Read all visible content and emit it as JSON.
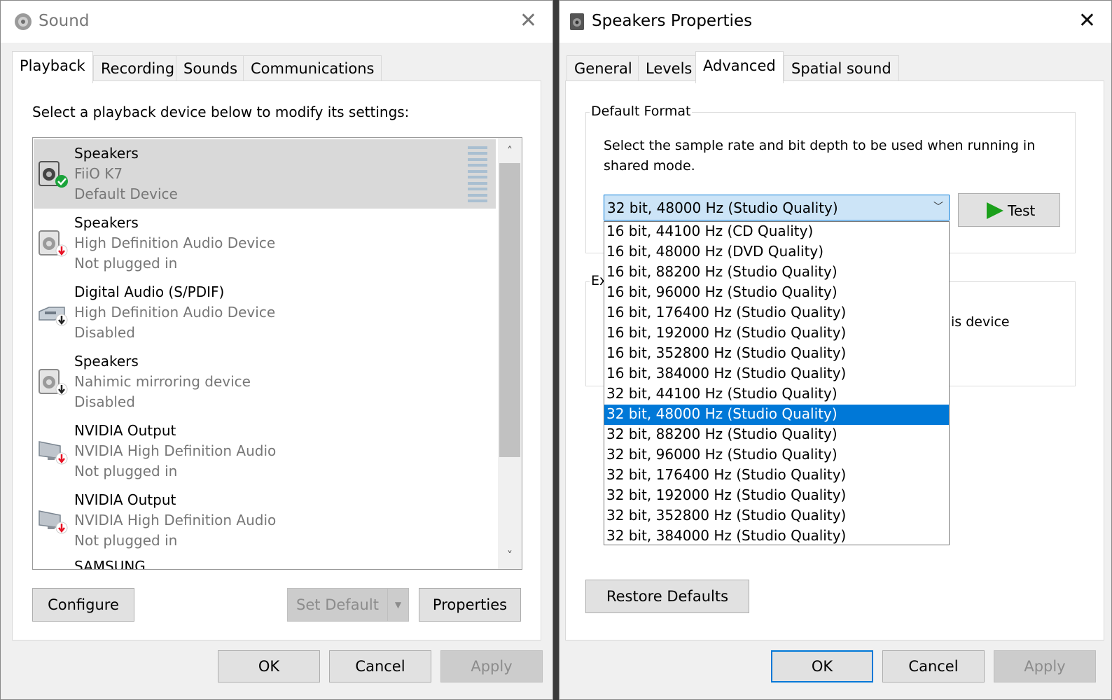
{
  "sound_window": {
    "title": "Sound",
    "close_glyph": "✕",
    "tabs": [
      {
        "label": "Playback",
        "active": true
      },
      {
        "label": "Recording",
        "active": false
      },
      {
        "label": "Sounds",
        "active": false
      },
      {
        "label": "Communications",
        "active": false
      }
    ],
    "instruction": "Select a playback device below to modify its settings:",
    "devices": [
      {
        "name": "Speakers",
        "description": "FiiO K7",
        "status": "Default Device",
        "icon": "speaker-icon",
        "badge": "default-check-icon",
        "selected": true
      },
      {
        "name": "Speakers",
        "description": "High Definition Audio Device",
        "status": "Not plugged in",
        "icon": "speaker-icon",
        "badge": "unplugged-arrow-icon",
        "selected": false
      },
      {
        "name": "Digital Audio (S/PDIF)",
        "description": "High Definition Audio Device",
        "status": "Disabled",
        "icon": "digital-audio-icon",
        "badge": "disabled-arrow-icon",
        "selected": false
      },
      {
        "name": "Speakers",
        "description": "Nahimic mirroring device",
        "status": "Disabled",
        "icon": "speaker-icon",
        "badge": "disabled-arrow-icon",
        "selected": false
      },
      {
        "name": "NVIDIA Output",
        "description": "NVIDIA High Definition Audio",
        "status": "Not plugged in",
        "icon": "monitor-icon",
        "badge": "unplugged-arrow-icon",
        "selected": false
      },
      {
        "name": "NVIDIA Output",
        "description": "NVIDIA High Definition Audio",
        "status": "Not plugged in",
        "icon": "monitor-icon",
        "badge": "unplugged-arrow-icon",
        "selected": false
      }
    ],
    "partial_device_name": "SAMSUNG",
    "scroll_up_glyph": "˄",
    "scroll_down_glyph": "˅",
    "buttons": {
      "configure": "Configure",
      "set_default": "Set Default",
      "properties": "Properties",
      "ok": "OK",
      "cancel": "Cancel",
      "apply": "Apply"
    }
  },
  "props_window": {
    "title": "Speakers Properties",
    "close_glyph": "✕",
    "tabs": [
      {
        "label": "General",
        "active": false
      },
      {
        "label": "Levels",
        "active": false
      },
      {
        "label": "Advanced",
        "active": true
      },
      {
        "label": "Spatial sound",
        "active": false
      }
    ],
    "default_format": {
      "legend": "Default Format",
      "description": "Select the sample rate and bit depth to be used when running in shared mode.",
      "selected_value": "32 bit, 48000 Hz (Studio Quality)",
      "test_label": "Test"
    },
    "exclusive_partial_legend": "Ex",
    "exclusive_partial_text": "is device",
    "dropdown_options": [
      "16 bit, 44100 Hz (CD Quality)",
      "16 bit, 48000 Hz (DVD Quality)",
      "16 bit, 88200 Hz (Studio Quality)",
      "16 bit, 96000 Hz (Studio Quality)",
      "16 bit, 176400 Hz (Studio Quality)",
      "16 bit, 192000 Hz (Studio Quality)",
      "16 bit, 352800 Hz (Studio Quality)",
      "16 bit, 384000 Hz (Studio Quality)",
      "32 bit, 44100 Hz (Studio Quality)",
      "32 bit, 48000 Hz (Studio Quality)",
      "32 bit, 88200 Hz (Studio Quality)",
      "32 bit, 96000 Hz (Studio Quality)",
      "32 bit, 176400 Hz (Studio Quality)",
      "32 bit, 192000 Hz (Studio Quality)",
      "32 bit, 352800 Hz (Studio Quality)",
      "32 bit, 384000 Hz (Studio Quality)"
    ],
    "dropdown_selected_index": 9,
    "buttons": {
      "restore_defaults": "Restore Defaults",
      "ok": "OK",
      "cancel": "Cancel",
      "apply": "Apply"
    }
  },
  "colors": {
    "accent": "#0078d7",
    "selection_bg": "#d9d9d9",
    "combo_bg": "#cce4f7",
    "play_green": "#1ba01b",
    "check_green": "#1aa33a",
    "arrow_red": "#e81123"
  }
}
